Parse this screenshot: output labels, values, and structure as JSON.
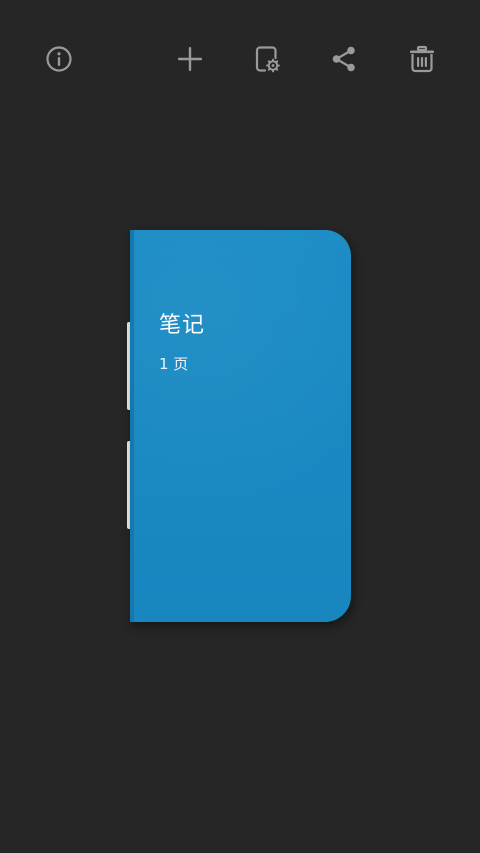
{
  "toolbar": {
    "icons": [
      "info-icon",
      "add-icon",
      "notebook-settings-icon",
      "share-icon",
      "delete-icon"
    ],
    "icon_color": "#9a9a9a"
  },
  "notebook": {
    "title": "笔记",
    "pages": "1 页",
    "cover_color": "#1a8ac4"
  },
  "colors": {
    "background": "#262626",
    "text": "#ffffff"
  }
}
